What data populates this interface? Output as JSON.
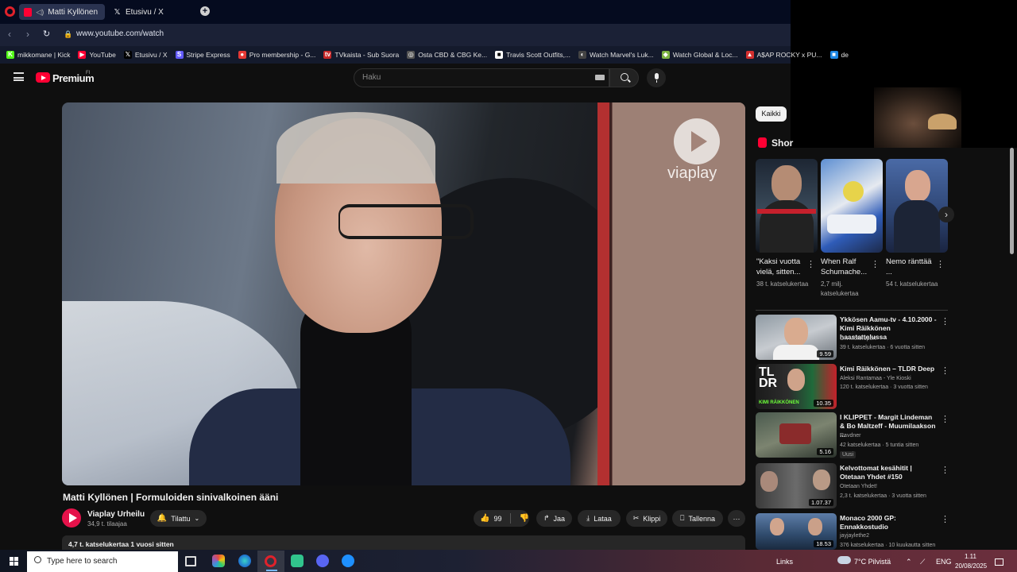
{
  "browser": {
    "tabs": [
      {
        "label": "Matti Kyllönen | Form"
      },
      {
        "label": "Etusivu / X"
      }
    ],
    "url": "www.youtube.com/watch",
    "bookmarks": [
      {
        "label": "mikkomane | Kick",
        "color": "#53fc18",
        "glyph": "K"
      },
      {
        "label": "YouTube",
        "color": "#ff0033",
        "glyph": "▶"
      },
      {
        "label": "Etusivu / X",
        "color": "#000000",
        "glyph": "𝕏"
      },
      {
        "label": "Stripe Express",
        "color": "#635bff",
        "glyph": "S"
      },
      {
        "label": "Pro membership - G...",
        "color": "#e53935",
        "glyph": "●"
      },
      {
        "label": "TVkaista - Sub Suora",
        "color": "#c62828",
        "glyph": "tv"
      },
      {
        "label": "Osta CBD & CBG Ke...",
        "color": "#555555",
        "glyph": "◎"
      },
      {
        "label": "Travis Scott Outfits,...",
        "color": "#ffffff",
        "glyph": "■"
      },
      {
        "label": "Watch Marvel's Luk...",
        "color": "#444444",
        "glyph": "◐"
      },
      {
        "label": "Watch Global & Loc...",
        "color": "#7cb342",
        "glyph": "◆"
      },
      {
        "label": "A$AP ROCKY x PU...",
        "color": "#d32f2f",
        "glyph": "▲"
      },
      {
        "label": "de",
        "color": "#1e88e5",
        "glyph": "■"
      }
    ]
  },
  "header": {
    "brand": "Premium",
    "region": "FI",
    "search_placeholder": "Haku"
  },
  "video": {
    "title": "Matti Kyllönen | Formuloiden sinivalkoinen ääni",
    "watermark": "viaplay",
    "channel": "Viaplay Urheilu",
    "subscribers": "34,9 t. tilaajaa",
    "subscribe_label": "Tilattu",
    "likes": "99",
    "share_label": "Jaa",
    "download_label": "Lataa",
    "clip_label": "Klippi",
    "save_label": "Tallenna",
    "description_meta": "4,7 t. katselukertaa  1 vuosi sitten"
  },
  "sidebar": {
    "chip_all": "Kaikki",
    "shorts_label": "Shor",
    "shorts": [
      {
        "title": "\"Kaksi vuotta vielä, sitten...",
        "views": "38 t. katselukertaa"
      },
      {
        "title": "When Ralf Schumache...",
        "views": "2,7 milj. katselukertaa"
      },
      {
        "title": "Nemo ränttää ...",
        "views": "54 t. katselukertaa"
      }
    ],
    "videos": [
      {
        "title": "Ykkösen Aamu-tv - 4.10.2000 - Kimi Räikkönen haastattelussa",
        "channel": "OK Motorsport",
        "meta": "39 t. katselukertaa · 6 vuotta sitten",
        "duration": "9.59"
      },
      {
        "title": "Kimi Räikkönen – TLDR Deep",
        "channel": "Aleksi Rantamaa - Yle Kioski",
        "meta": "120 t. katselukertaa · 3 vuotta sitten",
        "duration": "10.35"
      },
      {
        "title": "I KLIPPET - Margit Lindeman & Bo Maltzeff - Muumilaakson ...",
        "channel": "Ravdner",
        "meta": "42 katselukertaa · 5 tuntia sitten",
        "duration": "5.16",
        "badge": "Uusi"
      },
      {
        "title": "Kelvottomat kesähitit | Otetaan Yhdet #150",
        "channel": "Otetaan Yhdet!",
        "meta": "2,3 t. katselukertaa · 3 vuotta sitten",
        "duration": "1.07.37"
      },
      {
        "title": "Monaco 2000 GP: Ennakkostudio",
        "channel": "jayjaylethe2",
        "meta": "376 katselukertaa · 10 kuukautta sitten",
        "duration": "18.53"
      }
    ]
  },
  "taskbar": {
    "search_placeholder": "Type here to search",
    "links_label": "Links",
    "weather": "7°C  Pilvistä",
    "language": "ENG",
    "time": "1.11",
    "date": "20/08/2025"
  }
}
